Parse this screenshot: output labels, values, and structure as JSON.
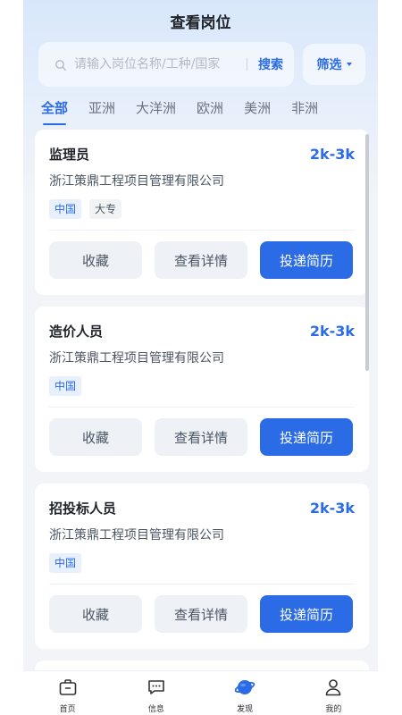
{
  "header": {
    "title": "查看岗位"
  },
  "search": {
    "placeholder": "请输入岗位名称/工种/国家",
    "button_label": "搜索"
  },
  "filter": {
    "label": "筛选"
  },
  "tabs": [
    {
      "label": "全部",
      "active": true
    },
    {
      "label": "亚洲",
      "active": false
    },
    {
      "label": "大洋洲",
      "active": false
    },
    {
      "label": "欧洲",
      "active": false
    },
    {
      "label": "美洲",
      "active": false
    },
    {
      "label": "非洲",
      "active": false
    }
  ],
  "jobs": [
    {
      "title": "监理员",
      "salary": "2k-3k",
      "company": "浙江策鼎工程项目管理有限公司",
      "tags": [
        "中国",
        "大专"
      ]
    },
    {
      "title": "造价人员",
      "salary": "2k-3k",
      "company": "浙江策鼎工程项目管理有限公司",
      "tags": [
        "中国"
      ]
    },
    {
      "title": "招投标人员",
      "salary": "2k-3k",
      "company": "浙江策鼎工程项目管理有限公司",
      "tags": [
        "中国"
      ]
    }
  ],
  "card_actions": {
    "favorite": "收藏",
    "details": "查看详情",
    "apply": "投递简历"
  },
  "tabbar": [
    {
      "label": "首页",
      "icon": "briefcase-icon"
    },
    {
      "label": "信息",
      "icon": "message-icon"
    },
    {
      "label": "发现",
      "icon": "planet-icon",
      "active": true
    },
    {
      "label": "我的",
      "icon": "user-icon"
    }
  ],
  "colors": {
    "accent": "#2b6be6",
    "background": "#f2f4f7"
  }
}
